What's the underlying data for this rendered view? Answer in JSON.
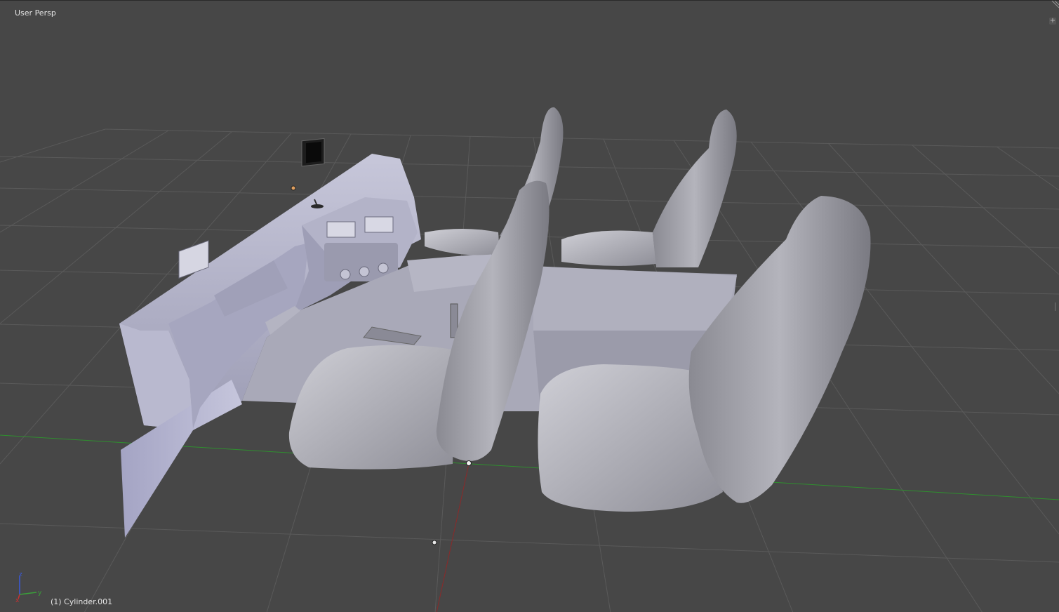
{
  "viewport": {
    "view_label": "User Persp",
    "object_label": "(1) Cylinder.001"
  },
  "axis_gizmo": {
    "x": "x",
    "y": "y",
    "z": "z"
  },
  "icons": {
    "corner_expand": "plus-icon",
    "axis_gizmo": "axis-gizmo-icon"
  },
  "colors": {
    "background": "#474747",
    "grid": "#595959",
    "x_axis": "#8b2a2a",
    "y_axis": "#2f8f2f",
    "mesh": "#b9b9c7"
  }
}
